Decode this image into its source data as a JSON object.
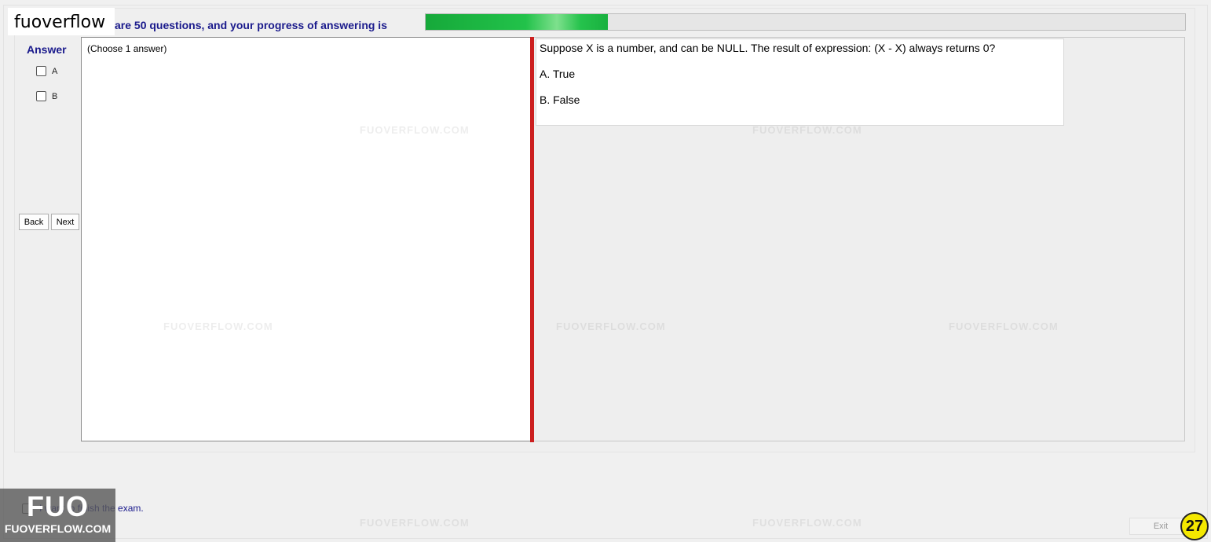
{
  "watermark_top": "fuoverflow",
  "header": {
    "progress_text": "are 50 questions, and your progress of answering is",
    "progress": 0.24
  },
  "answer_panel": {
    "label": "Answer",
    "options": [
      "A",
      "B"
    ],
    "back_label": "Back",
    "next_label": "Next"
  },
  "left_pane": {
    "instruction": "(Choose 1 answer)"
  },
  "question": {
    "text": "Suppose X is a number, and can be NULL. The result of expression: (X - X) always returns 0?",
    "options": [
      "A.  True",
      "B.  False"
    ]
  },
  "watermark_text": "FUOVERFLOW.COM",
  "footer": {
    "finish_text": "I want to finish the exam.",
    "exit_label": "Exit",
    "page_number": "27"
  },
  "logo": {
    "big": "FUO",
    "small": "FUOVERFLOW.COM"
  },
  "colors": {
    "accent_text": "#1a1a8c",
    "progress": "#22c24a",
    "splitter": "#cc1f1f",
    "badge": "#f4e800"
  }
}
